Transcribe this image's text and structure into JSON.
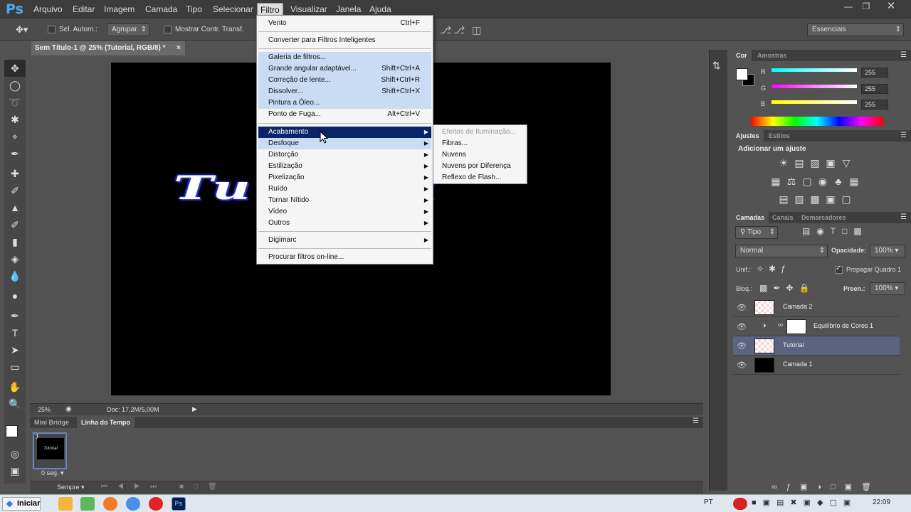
{
  "app": {
    "logo": "Ps"
  },
  "menubar": {
    "items": [
      "Arquivo",
      "Editar",
      "Imagem",
      "Camada",
      "Tipo",
      "Selecionar",
      "Filtro",
      "Visualizar",
      "Janela",
      "Ajuda"
    ],
    "active": "Filtro"
  },
  "options_bar": {
    "auto_select_label": "Sel. Autom.:",
    "group_value": "Agrupar",
    "show_transform_label": "Mostrar Contr. Transf.",
    "workspace_value": "Essenciais"
  },
  "document": {
    "tab_title": "Sem Título-1 @ 25% (Tutorial, RGB/8) *",
    "canvas_text": "Tutorial",
    "zoom": "25%",
    "doc_size": "Doc: 17,2M/5,00M"
  },
  "timeline": {
    "tabs": [
      "Mini Bridge",
      "Linha do Tempo"
    ],
    "active_tab": "Linha do Tempo",
    "frame_number": "1",
    "frame_delay": "0 seg.",
    "loop_value": "Sempre"
  },
  "filter_menu": {
    "items": [
      {
        "label": "Vento",
        "shortcut": "Ctrl+F"
      },
      {
        "label": "Converter para Filtros Inteligentes",
        "shortcut": ""
      },
      {
        "label": "Galeria de filtros...",
        "shortcut": ""
      },
      {
        "label": "Grande angular adaptável...",
        "shortcut": "Shift+Ctrl+A"
      },
      {
        "label": "Correção de lente...",
        "shortcut": "Shift+Ctrl+R"
      },
      {
        "label": "Dissolver...",
        "shortcut": "Shift+Ctrl+X"
      },
      {
        "label": "Pintura a Óleo...",
        "shortcut": ""
      },
      {
        "label": "Ponto de Fuga...",
        "shortcut": "Alt+Ctrl+V"
      },
      {
        "label": "Acabamento",
        "shortcut": ""
      },
      {
        "label": "Desfoque",
        "shortcut": ""
      },
      {
        "label": "Distorção",
        "shortcut": ""
      },
      {
        "label": "Estilização",
        "shortcut": ""
      },
      {
        "label": "Pixelização",
        "shortcut": ""
      },
      {
        "label": "Ruído",
        "shortcut": ""
      },
      {
        "label": "Tornar Nítido",
        "shortcut": ""
      },
      {
        "label": "Vídeo",
        "shortcut": ""
      },
      {
        "label": "Outros",
        "shortcut": ""
      },
      {
        "label": "Digimarc",
        "shortcut": ""
      },
      {
        "label": "Procurar filtros on-line...",
        "shortcut": ""
      }
    ],
    "submenu_arrow": "▶"
  },
  "submenu": {
    "items": [
      "Efeitos de Iluminação...",
      "Fibras...",
      "Nuvens",
      "Nuvens por Diferença",
      "Reflexo de Flash..."
    ]
  },
  "color_panel": {
    "tabs": [
      "Cor",
      "Amostras"
    ],
    "channels": [
      {
        "label": "R",
        "value": "255"
      },
      {
        "label": "G",
        "value": "255"
      },
      {
        "label": "B",
        "value": "255"
      }
    ]
  },
  "adjust_panel": {
    "tabs": [
      "Ajustes",
      "Estilos"
    ],
    "heading": "Adicionar um ajuste"
  },
  "layers_panel": {
    "tabs": [
      "Camadas",
      "Canais",
      "Demarcadores"
    ],
    "filter_kind": "Tipo",
    "blend_mode": "Normal",
    "opacity_label": "Opacidade:",
    "opacity_value": "100%",
    "unify_label": "Unif.:",
    "propagate_label": "Propagar Quadro 1",
    "lock_label": "Bloq.:",
    "fill_label": "Preen.:",
    "fill_value": "100%",
    "layers": [
      {
        "name": "Camada 2"
      },
      {
        "name": "Equilíbrio de Cores 1"
      },
      {
        "name": "Tutorial"
      },
      {
        "name": "Camada 1"
      }
    ]
  },
  "taskbar": {
    "start_label": "Iniciar",
    "language": "PT",
    "time": "22:09"
  }
}
